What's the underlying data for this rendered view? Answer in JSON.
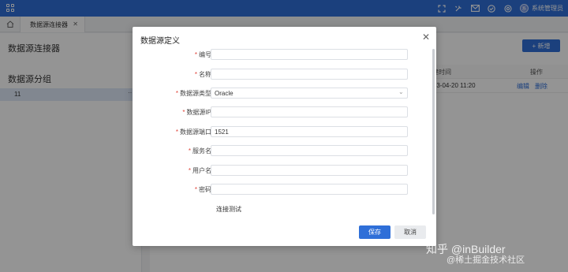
{
  "header": {
    "user_name": "系统管理员",
    "avatar_text": "系"
  },
  "tabs": [
    {
      "label": "数据源连接器"
    }
  ],
  "page": {
    "title": "数据源连接器",
    "group_title": "数据源分组",
    "groups": [
      {
        "label": "11",
        "more": "···"
      }
    ],
    "add_button": "+ 新增",
    "table": {
      "headers": {
        "time": "创建时间",
        "actions": "操作"
      },
      "rows": [
        {
          "time": "2023-04-20 11:20",
          "edit": "编辑",
          "delete": "删除"
        }
      ]
    }
  },
  "dialog": {
    "title": "数据源定义",
    "fields": [
      {
        "label": "编号",
        "value": "",
        "required": true
      },
      {
        "label": "名称",
        "value": "",
        "required": true
      },
      {
        "label": "数据源类型",
        "value": "Oracle",
        "required": true
      },
      {
        "label": "数据源IP",
        "value": "",
        "required": true
      },
      {
        "label": "数据源端口",
        "value": "1521",
        "required": true
      },
      {
        "label": "服务名",
        "value": "",
        "required": true
      },
      {
        "label": "用户名",
        "value": "",
        "required": true
      },
      {
        "label": "密码",
        "value": "",
        "required": true
      }
    ],
    "test_button": "连接测试",
    "save_button": "保存",
    "cancel_button": "取消"
  },
  "watermark": {
    "line1": "知乎 @inBuilder",
    "line2": "@稀土掘金技术社区"
  },
  "colors": {
    "primary": "#2f6fd8",
    "required": "#e0463b"
  }
}
